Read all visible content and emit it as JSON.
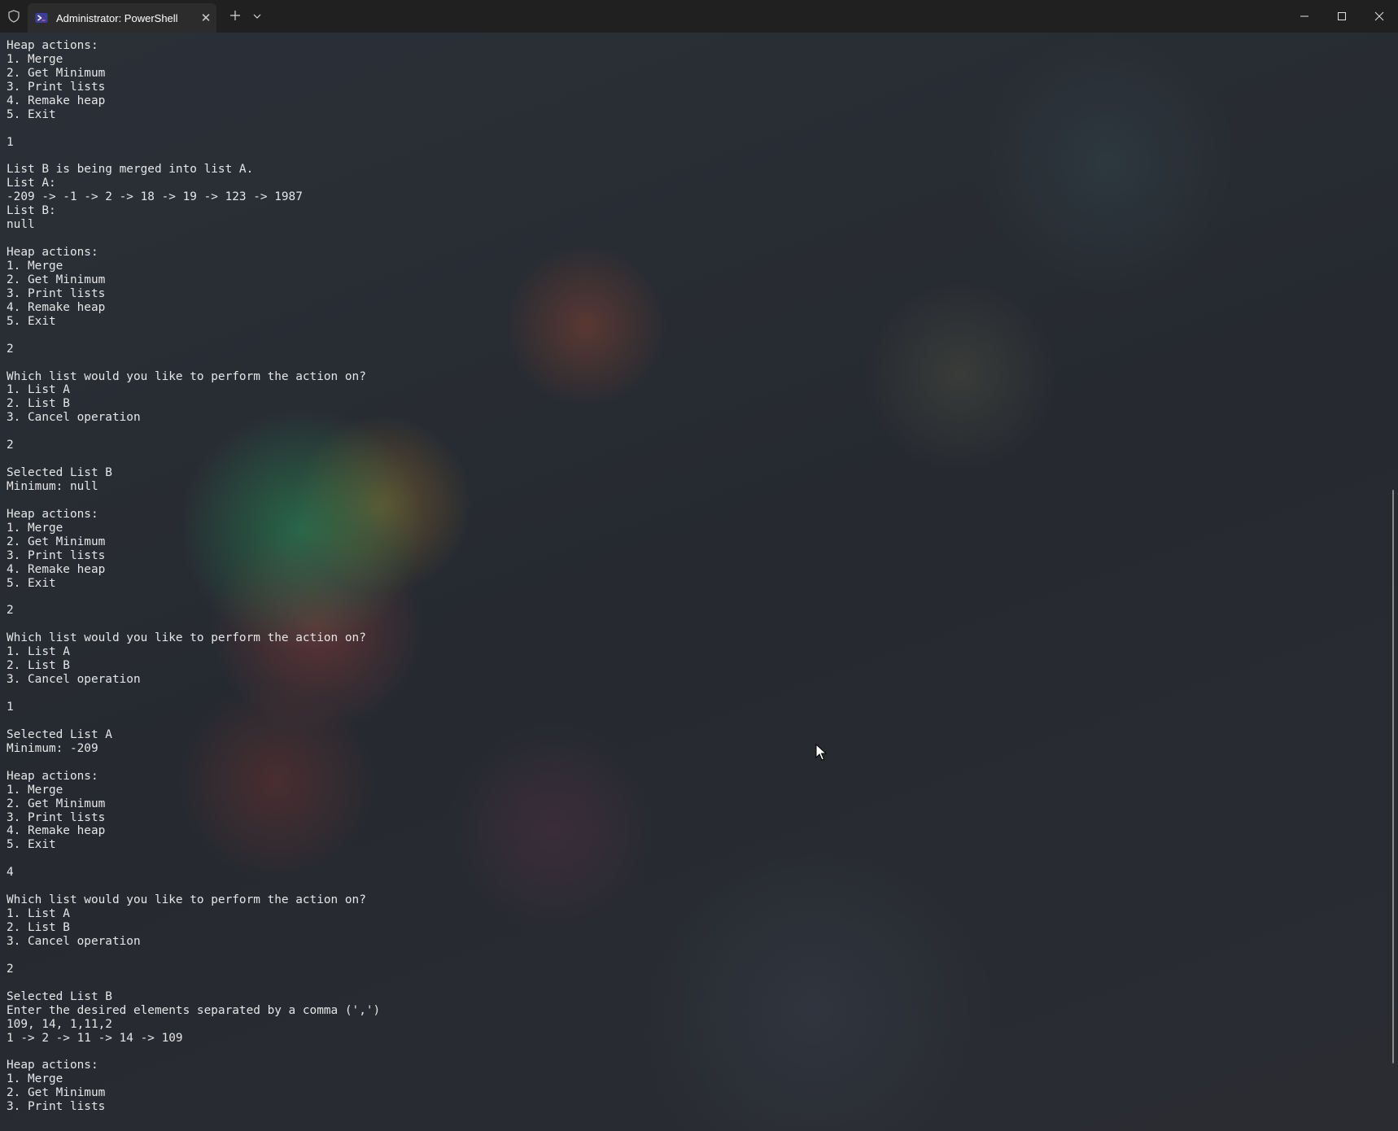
{
  "window": {
    "tab_title": "Administrator: PowerShell",
    "icons": {
      "shield": "shield-icon",
      "tab": "powershell-icon",
      "close_tab": "close-icon",
      "new_tab": "plus-icon",
      "dropdown": "chevron-down-icon",
      "minimize": "minimize-icon",
      "maximize": "maximize-icon",
      "close_window": "close-icon"
    }
  },
  "terminal": {
    "lines": [
      "Heap actions:",
      "1. Merge",
      "2. Get Minimum",
      "3. Print lists",
      "4. Remake heap",
      "5. Exit",
      "",
      "1",
      "",
      "List B is being merged into list A.",
      "List A:",
      "-209 -> -1 -> 2 -> 18 -> 19 -> 123 -> 1987",
      "List B:",
      "null",
      "",
      "Heap actions:",
      "1. Merge",
      "2. Get Minimum",
      "3. Print lists",
      "4. Remake heap",
      "5. Exit",
      "",
      "2",
      "",
      "Which list would you like to perform the action on?",
      "1. List A",
      "2. List B",
      "3. Cancel operation",
      "",
      "2",
      "",
      "Selected List B",
      "Minimum: null",
      "",
      "Heap actions:",
      "1. Merge",
      "2. Get Minimum",
      "3. Print lists",
      "4. Remake heap",
      "5. Exit",
      "",
      "2",
      "",
      "Which list would you like to perform the action on?",
      "1. List A",
      "2. List B",
      "3. Cancel operation",
      "",
      "1",
      "",
      "Selected List A",
      "Minimum: -209",
      "",
      "Heap actions:",
      "1. Merge",
      "2. Get Minimum",
      "3. Print lists",
      "4. Remake heap",
      "5. Exit",
      "",
      "4",
      "",
      "Which list would you like to perform the action on?",
      "1. List A",
      "2. List B",
      "3. Cancel operation",
      "",
      "2",
      "",
      "Selected List B",
      "Enter the desired elements separated by a comma (',')",
      "109, 14, 1,11,2",
      "1 -> 2 -> 11 -> 14 -> 109",
      "",
      "Heap actions:",
      "1. Merge",
      "2. Get Minimum",
      "3. Print lists"
    ]
  }
}
